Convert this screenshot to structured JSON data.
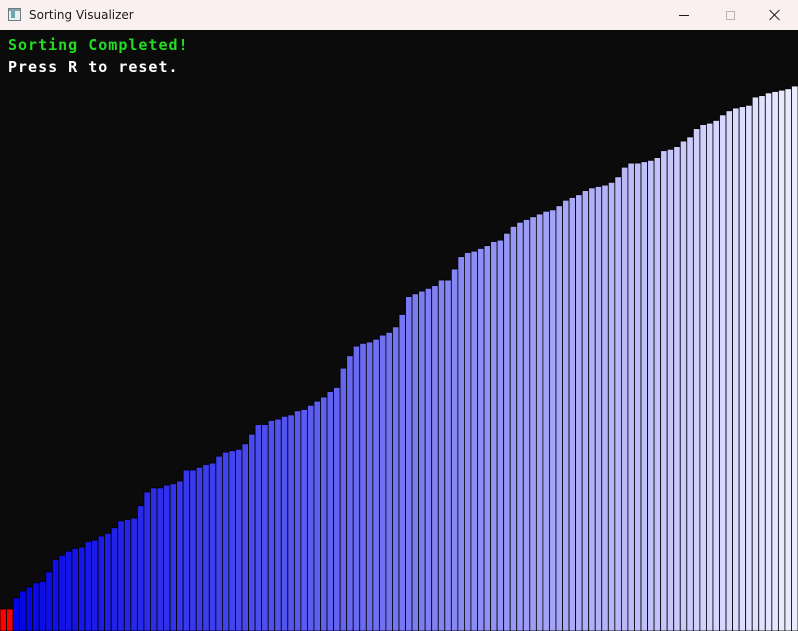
{
  "window": {
    "title": "Sorting Visualizer",
    "icon": "app-window-icon",
    "controls": [
      "minimize-icon",
      "maximize-icon",
      "close-icon"
    ]
  },
  "status": {
    "title": "Sorting Completed!",
    "hint": "Press R to reset.",
    "title_color": "#22dd22",
    "hint_color": "#ffffff"
  },
  "colors": {
    "background": "#0b0b0b",
    "bar_start": "#0000e6",
    "bar_end": "#ececff",
    "highlight": "#ff0000",
    "bar_outline": "#000000"
  },
  "chart_data": {
    "type": "bar",
    "description_note": "",
    "values": [
      16,
      16,
      24,
      29,
      32,
      35,
      36,
      43,
      52,
      55,
      58,
      60,
      61,
      65,
      66,
      69,
      71,
      75,
      80,
      81,
      82,
      91,
      101,
      104,
      104,
      106,
      107,
      109,
      117,
      117,
      119,
      121,
      122,
      127,
      130,
      131,
      132,
      136,
      143,
      150,
      150,
      153,
      154,
      156,
      157,
      160,
      161,
      164,
      167,
      170,
      174,
      177,
      191,
      200,
      207,
      209,
      210,
      212,
      215,
      217,
      221,
      230,
      243,
      245,
      247,
      249,
      251,
      255,
      255,
      263,
      272,
      275,
      276,
      278,
      280,
      283,
      284,
      289,
      294,
      297,
      299,
      301,
      303,
      305,
      306,
      309,
      313,
      315,
      317,
      320,
      322,
      323,
      324,
      326,
      330,
      337,
      340,
      340,
      341,
      342,
      344,
      349,
      350,
      352,
      356,
      359,
      365,
      368,
      369,
      371,
      375,
      378,
      380,
      381,
      382,
      388,
      389,
      391,
      392,
      393,
      394,
      396
    ],
    "highlighted_indices": [
      0,
      1
    ],
    "ylim": [
      0,
      400
    ]
  }
}
